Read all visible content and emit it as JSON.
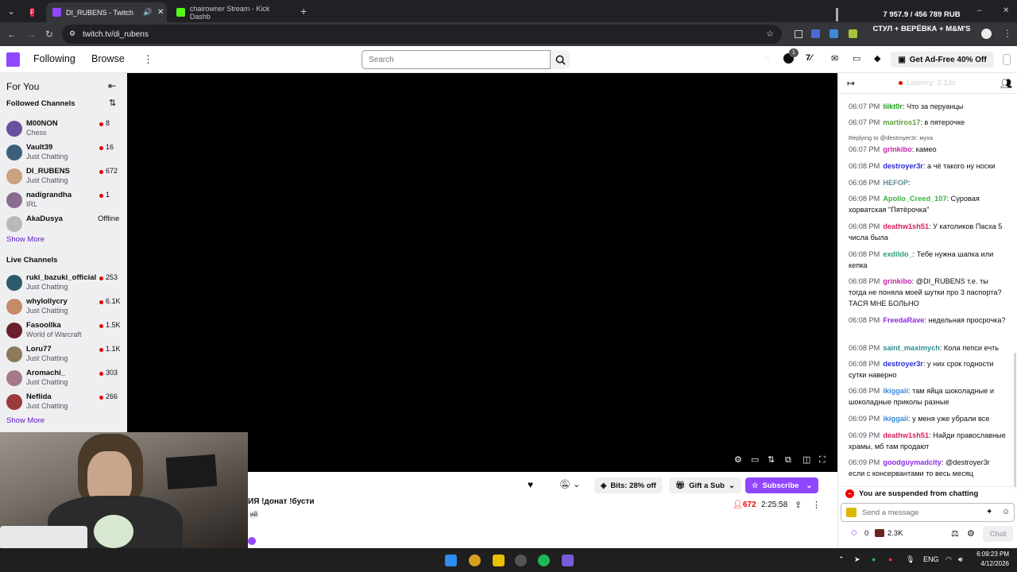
{
  "browser": {
    "tabs": [
      {
        "label": "F",
        "color": "#e11d48"
      },
      {
        "label": "DI_RUBENS - Twitch",
        "color": "#9147ff"
      },
      {
        "label": "chairowner Stream - Kick Dashb",
        "color": "#53fc18"
      }
    ],
    "url": "twitch.tv/di_rubens",
    "overlay_line1": "7 957.9 / 456 789 RUB",
    "overlay_line2": "СТУЛ + ВЕРЁВКА + M&M'S"
  },
  "topnav": {
    "following": "Following",
    "browse": "Browse",
    "search_placeholder": "Search",
    "notif_count": "1",
    "adfree": "Get Ad-Free 40% Off"
  },
  "sidebar": {
    "for_you": "For You",
    "followed_title": "Followed Channels",
    "followed": [
      {
        "name": "M00NON",
        "game": "Chess",
        "viewers": "8",
        "color": "#6b4fa0"
      },
      {
        "name": "Vault39",
        "game": "Just Chatting",
        "viewers": "16",
        "color": "#3b5f7a"
      },
      {
        "name": "DI_RUBENS",
        "game": "Just Chatting",
        "viewers": "672",
        "color": "#c9a27e"
      },
      {
        "name": "nadigrandha",
        "game": "IRL",
        "viewers": "1",
        "color": "#8a6c8e"
      },
      {
        "name": "AkaDusya",
        "game": "",
        "viewers": "Offline",
        "color": "#b8b8b8"
      }
    ],
    "show_more": "Show More",
    "live_title": "Live Channels",
    "live": [
      {
        "name": "ruki_bazuki_official",
        "game": "Just Chatting",
        "viewers": "253",
        "color": "#2d5a6b"
      },
      {
        "name": "whylollycry",
        "game": "Just Chatting",
        "viewers": "6.1K",
        "color": "#c58a6a"
      },
      {
        "name": "Fasoollka",
        "game": "World of Warcraft",
        "viewers": "1.5K",
        "color": "#6b1f2a"
      },
      {
        "name": "Loru77",
        "game": "Just Chatting",
        "viewers": "1.1K",
        "color": "#8c7a5a"
      },
      {
        "name": "Aromachi_",
        "game": "Just Chatting",
        "viewers": "303",
        "color": "#a57a8a"
      },
      {
        "name": "Neflida",
        "game": "Just Chatting",
        "viewers": "266",
        "color": "#9a3a3a"
      }
    ],
    "show_more2": "Show More"
  },
  "infobar": {
    "bits": "Bits: 28% off",
    "gift": "Gift a Sub",
    "subscribe": "Subscribe",
    "title": "ИЯ !донат !бусти",
    "tag": "ий",
    "viewers": "672",
    "uptime": "2:25:58"
  },
  "chat": {
    "latency": "Latency: 3.13s",
    "messages": [
      {
        "time": "06:07 PM",
        "user": "liikt0r",
        "color": "#1e9e1e",
        "text": ": Что за перуанцы"
      },
      {
        "time": "06:07 PM",
        "user": "martiros17",
        "color": "#5f9e3a",
        "text": ": в пятерочке"
      },
      {
        "reply": "Replying to @destroyer3r: муха"
      },
      {
        "time": "06:07 PM",
        "user": "grinkibo",
        "color": "#c026a8",
        "text": ": камео"
      },
      {
        "time": "06:08 PM",
        "user": "destroyer3r",
        "color": "#2a2ad8",
        "text": ": а чё такого ну носки"
      },
      {
        "time": "06:08 PM",
        "user": "HEFOP",
        "color": "#5f8a9a",
        "text": ":"
      },
      {
        "time": "06:08 PM",
        "user": "Apollo_Creed_107",
        "color": "#3cb043",
        "text": ": Суровая хорватская \"Пятёрочка\""
      },
      {
        "time": "06:08 PM",
        "user": "deathw1sh51",
        "color": "#d81b60",
        "text": ": У католиков Пасха 5 числа была"
      },
      {
        "time": "06:08 PM",
        "user": "exdildo_",
        "color": "#2e9e6e",
        "text": ": Тебе нужна шапка или кепка"
      },
      {
        "time": "06:08 PM",
        "user": "grinkibo",
        "color": "#c026a8",
        "text": ": @DI_RUBENS т.е. ты тогда не поняла моей шутки про 3 паспорта? ТАСЯ МНЕ БОЛЬНО"
      },
      {
        "time": "06:08 PM",
        "user": "FreedaRave",
        "color": "#8a2be2",
        "text": ": недельная просрочка?"
      },
      {
        "time": "06:08 PM",
        "user": "saint_maximych",
        "color": "#2e8b8b",
        "text": ": Кола пепси ечть"
      },
      {
        "time": "06:08 PM",
        "user": "destroyer3r",
        "color": "#2a2ad8",
        "text": ": у них срок годности сутки наверно"
      },
      {
        "time": "06:08 PM",
        "user": "ikiggaii",
        "color": "#3a8ad8",
        "text": ": там яйца шоколадные и шоколадные приколы разные"
      },
      {
        "time": "06:09 PM",
        "user": "ikiggaii",
        "color": "#3a8ad8",
        "text": ": у меня уже убрали все"
      },
      {
        "time": "06:09 PM",
        "user": "deathw1sh51",
        "color": "#d81b60",
        "text": ": Найди православные храмы, мб там продают"
      },
      {
        "time": "06:09 PM",
        "user": "goodguymadcity",
        "color": "#8a2be2",
        "text": ": @destroyer3r если с консервантами то весь месяц"
      }
    ],
    "suspended": "You are suspended from chatting",
    "input_placeholder": "Send a message",
    "points": "0",
    "points2": "2.3K",
    "chat_button": "Chat"
  },
  "taskbar": {
    "lang": "ENG",
    "time": "6:09:23 PM",
    "date": "4/12/2026"
  }
}
